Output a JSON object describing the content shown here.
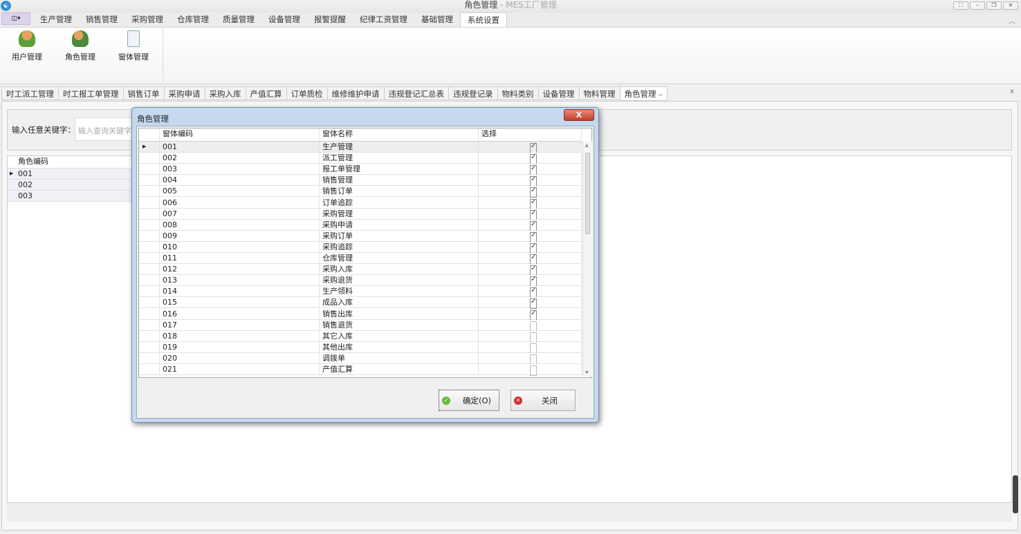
{
  "window": {
    "title": "角色管理",
    "title_suffix": " - MES工厂管理",
    "controls": [
      "⛶",
      "–",
      "❐",
      "✕"
    ]
  },
  "menu": {
    "app_button": "◫▾",
    "tabs": [
      "生产管理",
      "销售管理",
      "采购管理",
      "仓库管理",
      "质量管理",
      "设备管理",
      "报警提醒",
      "纪律工资管理",
      "基础管理",
      "系统设置"
    ],
    "active": "系统设置"
  },
  "ribbon": {
    "buttons": [
      {
        "label": "用户管理",
        "icon": "user-icon"
      },
      {
        "label": "角色管理",
        "icon": "role-gear-icon"
      },
      {
        "label": "窗体管理",
        "icon": "form-edit-icon"
      }
    ]
  },
  "doc_tabs": [
    "时工派工管理",
    "时工报工单管理",
    "销售订单",
    "采购申请",
    "采购入库",
    "产值汇算",
    "订单质检",
    "维修维护申请",
    "违规登记汇总表",
    "违规登记录",
    "物料类别",
    "设备管理",
    "物料管理",
    "角色管理"
  ],
  "search": {
    "label": "输入任意关键字：",
    "placeholder": "输入查询关键字"
  },
  "role_grid": {
    "header": "角色编码",
    "rows": [
      "001",
      "002",
      "003"
    ]
  },
  "dialog": {
    "title": "角色管理",
    "close": "X",
    "columns": [
      "窗体编码",
      "窗体名称",
      "选择"
    ],
    "rows": [
      {
        "code": "001",
        "name": "生产管理",
        "checked": true
      },
      {
        "code": "002",
        "name": "派工管理",
        "checked": true
      },
      {
        "code": "003",
        "name": "报工单管理",
        "checked": true
      },
      {
        "code": "004",
        "name": "销售管理",
        "checked": true
      },
      {
        "code": "005",
        "name": "销售订单",
        "checked": true
      },
      {
        "code": "006",
        "name": "订单追踪",
        "checked": true
      },
      {
        "code": "007",
        "name": "采购管理",
        "checked": true
      },
      {
        "code": "008",
        "name": "采购申请",
        "checked": true
      },
      {
        "code": "009",
        "name": "采购订单",
        "checked": true
      },
      {
        "code": "010",
        "name": "采购追踪",
        "checked": true
      },
      {
        "code": "011",
        "name": "仓库管理",
        "checked": true
      },
      {
        "code": "012",
        "name": "采购入库",
        "checked": true
      },
      {
        "code": "013",
        "name": "采购退货",
        "checked": true
      },
      {
        "code": "014",
        "name": "生产领料",
        "checked": true
      },
      {
        "code": "015",
        "name": "成品入库",
        "checked": true
      },
      {
        "code": "016",
        "name": "销售出库",
        "checked": true
      },
      {
        "code": "017",
        "name": "销售退货",
        "checked": false
      },
      {
        "code": "018",
        "name": "其它入库",
        "checked": false
      },
      {
        "code": "019",
        "name": "其他出库",
        "checked": false
      },
      {
        "code": "020",
        "name": "调拨单",
        "checked": false
      },
      {
        "code": "021",
        "name": "产值汇算",
        "checked": false
      }
    ],
    "ok_label": "确定(O)",
    "close_label": "关闭"
  }
}
